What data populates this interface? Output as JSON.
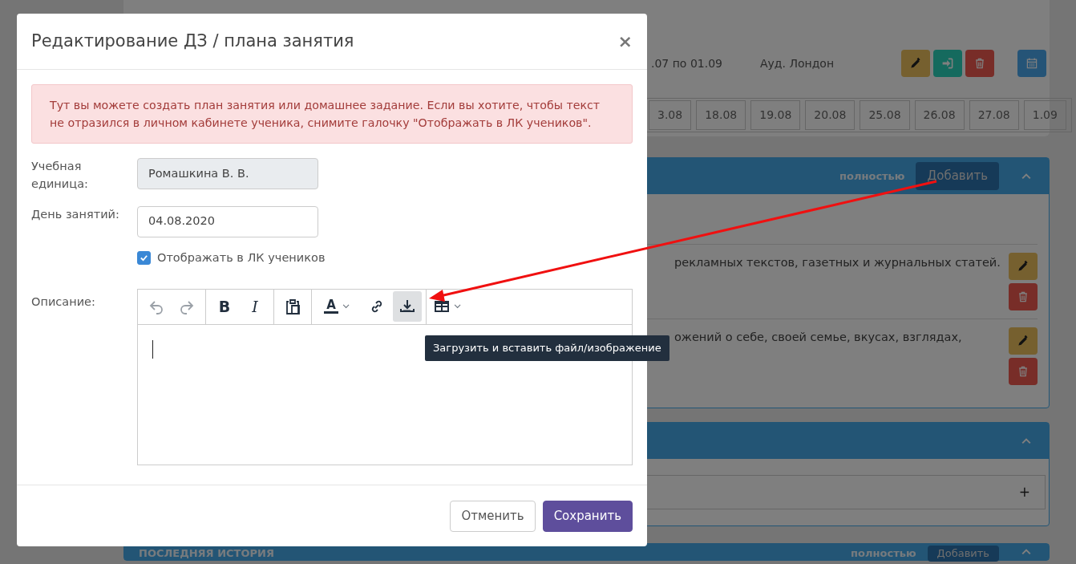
{
  "schedule": {
    "period": ".07 по 01.09",
    "room": "Ауд. Лондон",
    "actions": [
      {
        "kind": "edit"
      },
      {
        "kind": "enter"
      },
      {
        "kind": "delete"
      }
    ],
    "calendar": {
      "kind": "calendar"
    },
    "dates": [
      "3.08",
      "18.08",
      "19.08",
      "20.08",
      "25.08",
      "26.08",
      "27.08",
      "1.09"
    ]
  },
  "panels": [
    {
      "kind": "tasks",
      "link": "полностью",
      "add": "Добавить",
      "rows": [
        {
          "text": "рекламных текстов, газетных и журнальных статей."
        },
        {
          "text": "ожений о себе, своей семье, вкусах, взглядах,"
        }
      ]
    },
    {
      "kind": "entry",
      "plus": "+"
    },
    {
      "kind": "history",
      "title": "ПОСЛЕДНЯЯ ИСТОРИЯ",
      "link": "полностью",
      "add": "Добавить"
    }
  ],
  "modal": {
    "title": "Редактирование ДЗ / плана занятия",
    "close": "×",
    "alert": "Тут вы можете создать план занятия или домашнее задание. Если вы хотите, чтобы текст не отразился в личном кабинете ученика, снимите галочку \"Отображать в ЛК учеников\".",
    "fields": [
      {
        "label": "Учебная единица:",
        "value": "Ромашкина В. В.",
        "disabled": true
      },
      {
        "label": "День занятий:",
        "value": "04.08.2020",
        "disabled": false
      }
    ],
    "checkbox": {
      "label": "Отображать в ЛК учеников",
      "checked": true
    },
    "description_label": "Описание:",
    "toolbar": [
      [
        {
          "kind": "undo",
          "disabled": true,
          "highlighted": false
        },
        {
          "kind": "redo",
          "disabled": true,
          "highlighted": false
        }
      ],
      [
        {
          "kind": "bold",
          "label": "B",
          "disabled": false,
          "highlighted": false
        },
        {
          "kind": "italic",
          "label": "I",
          "disabled": false,
          "highlighted": false
        }
      ],
      [
        {
          "kind": "paste",
          "disabled": false,
          "highlighted": false
        }
      ],
      [
        {
          "kind": "textcolor",
          "label": "A",
          "disabled": false,
          "highlighted": false
        },
        {
          "kind": "link",
          "disabled": false,
          "highlighted": false
        },
        {
          "kind": "upload",
          "disabled": false,
          "highlighted": true
        }
      ],
      [
        {
          "kind": "table",
          "disabled": false,
          "highlighted": false
        }
      ]
    ],
    "tooltip": "Загрузить и вставить файл/изображение",
    "buttons": [
      {
        "label": "Отменить",
        "kind": "secondary"
      },
      {
        "label": "Сохранить",
        "kind": "primary"
      }
    ]
  }
}
